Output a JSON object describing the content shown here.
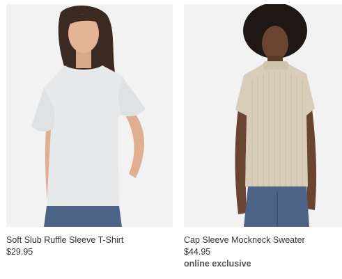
{
  "products": [
    {
      "image_alt": "Soft Slub Ruffle Sleeve T-Shirt",
      "name": "Soft Slub Ruffle Sleeve T-Shirt",
      "price": "$29.95",
      "badge": ""
    },
    {
      "image_alt": "Cap Sleeve Mockneck Sweater",
      "name": "Cap Sleeve Mockneck Sweater",
      "price": "$44.95",
      "badge": "online exclusive"
    }
  ],
  "colors": {
    "image_background": "#f2f2f2",
    "text": "#333333",
    "badge_text": "#595959",
    "tshirt": "#e6e8ea",
    "sweater": "#d7cdb9",
    "denim": "#4d6385"
  }
}
